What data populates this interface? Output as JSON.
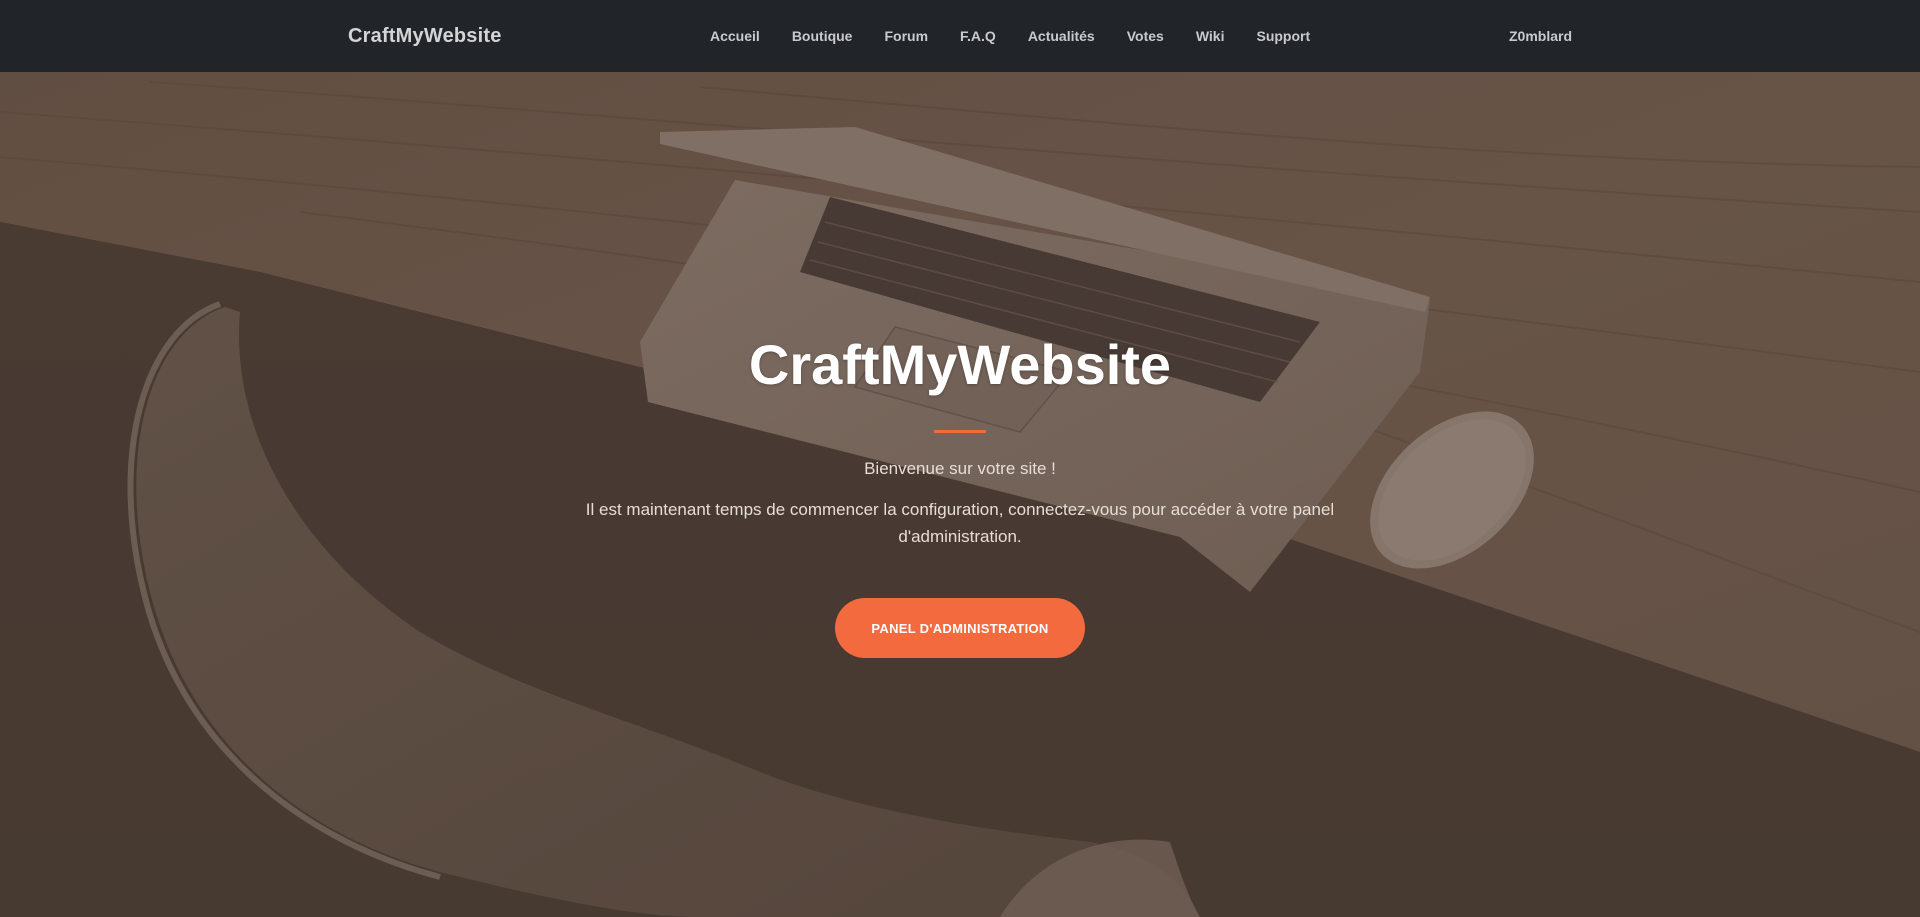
{
  "navbar": {
    "brand": "CraftMyWebsite",
    "links": [
      {
        "label": "Accueil"
      },
      {
        "label": "Boutique"
      },
      {
        "label": "Forum"
      },
      {
        "label": "F.A.Q"
      },
      {
        "label": "Actualités"
      },
      {
        "label": "Votes"
      },
      {
        "label": "Wiki"
      },
      {
        "label": "Support"
      }
    ],
    "user": "Z0mblard"
  },
  "hero": {
    "title": "CraftMyWebsite",
    "welcome": "Bienvenue sur votre site !",
    "text": "Il est maintenant temps de commencer la configuration, connectez-vous pour accéder à votre panel d'administration.",
    "button_label": "PANEL D'ADMINISTRATION",
    "background_image": "laptop-on-wooden-desk-photo"
  },
  "colors": {
    "navbar_bg": "#212529",
    "accent": "#f26a3d",
    "overlay": "#4f4138"
  }
}
